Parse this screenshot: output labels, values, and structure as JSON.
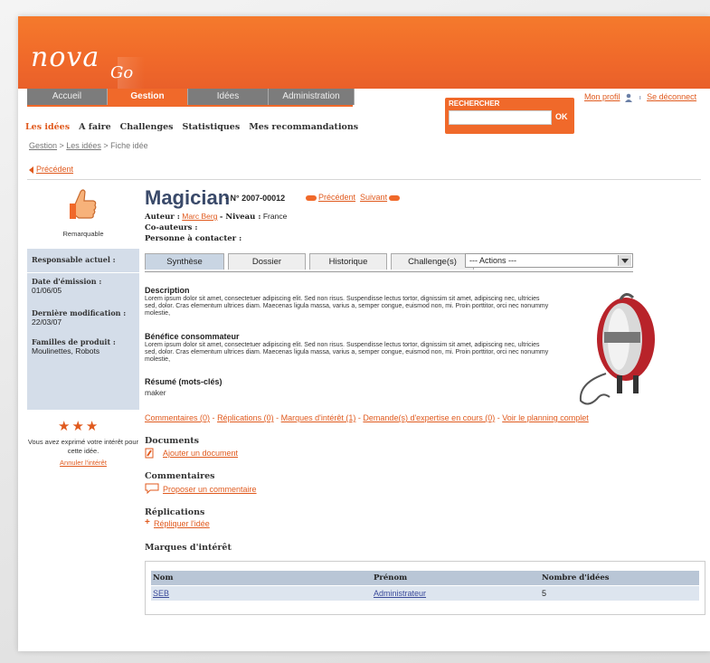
{
  "header": {
    "logo_main": "nova",
    "logo_sub": "Go",
    "tabs": [
      {
        "label": "Accueil",
        "active": false
      },
      {
        "label": "Gestion",
        "active": true
      },
      {
        "label": "Idées",
        "active": false
      },
      {
        "label": "Administration",
        "active": false
      }
    ],
    "search": {
      "label": "RECHERCHER",
      "value": "",
      "button": "OK"
    },
    "profile_link": "Mon profil",
    "logout_link": "Se déconnect"
  },
  "subnav": {
    "items": [
      "Les idées",
      "A faire",
      "Challenges",
      "Statistiques",
      "Mes recommandations"
    ],
    "active_index": 0
  },
  "breadcrumb": [
    "Gestion",
    "Les idées",
    "Fiche idée"
  ],
  "back_link": "Précédent",
  "left_panel": {
    "thumb_label": "Remarquable",
    "info": [
      {
        "label": "Responsable actuel :",
        "value": ""
      },
      {
        "label": "Date d'émission :",
        "value": "01/06/05"
      },
      {
        "label": "Dernière modification :",
        "value": "22/03/07"
      },
      {
        "label": "Familles de produit :",
        "value": "Moulinettes, Robots"
      }
    ],
    "stars": "★★★",
    "vote_text": "Vous avez exprimé votre intérêt pour cette idée.",
    "vote_link": "Annuler l'intérêt"
  },
  "idea": {
    "title": "Magician",
    "number": "- N° 2007-00012",
    "prev_link": "Précédent",
    "next_link": "Suivant",
    "author_label": "Auteur :",
    "author": "Marc Berg",
    "level_label": "- Niveau :",
    "level": "France",
    "coauthors_label": "Co-auteurs :",
    "contact_label": "Personne à contacter :"
  },
  "content_tabs": [
    "Synthèse",
    "Dossier",
    "Historique",
    "Challenge(s)"
  ],
  "actions_select": "--- Actions ---",
  "sections": {
    "description_title": "Description",
    "description_text": "Lorem ipsum dolor sit amet, consectetuer adipiscing elit. Sed non risus. Suspendisse lectus tortor, dignissim sit amet, adipiscing nec, ultricies sed, dolor. Cras elementum ultrices diam. Maecenas ligula massa, varius a, semper congue, euismod non, mi. Proin porttitor, orci nec nonummy molestie,",
    "benefit_title": "Bénéfice consommateur",
    "benefit_text": "Lorem ipsum dolor sit amet, consectetuer adipiscing elit. Sed non risus. Suspendisse lectus tortor, dignissim sit amet, adipiscing nec, ultricies sed, dolor. Cras elementum ultrices diam. Maecenas ligula massa, varius a, semper congue, euismod non, mi. Proin porttitor, orci nec nonummy molestie,",
    "summary_title": "Résumé (mots-clés)",
    "summary_text": "maker"
  },
  "links_row": [
    "Commentaires (0)",
    "Réplications (0)",
    "Marques d'intérêt (1)",
    "Demande(s) d'expertise en cours (0)",
    "Voir le planning complet"
  ],
  "blocks": {
    "documents_title": "Documents",
    "documents_link": "Ajouter un document",
    "comments_title": "Commentaires",
    "comments_link": "Proposer un commentaire",
    "replications_title": "Réplications",
    "replications_link": "Répliquer l'idée",
    "interest_title": "Marques d'intérêt"
  },
  "interest_table": {
    "headers": [
      "Nom",
      "Prénom",
      "Nombre d'idées"
    ],
    "rows": [
      [
        "SEB",
        "Administrateur",
        "5"
      ]
    ]
  },
  "colors": {
    "accent": "#f0692a",
    "panel": "#d4dde9",
    "title": "#3a4a6a"
  }
}
